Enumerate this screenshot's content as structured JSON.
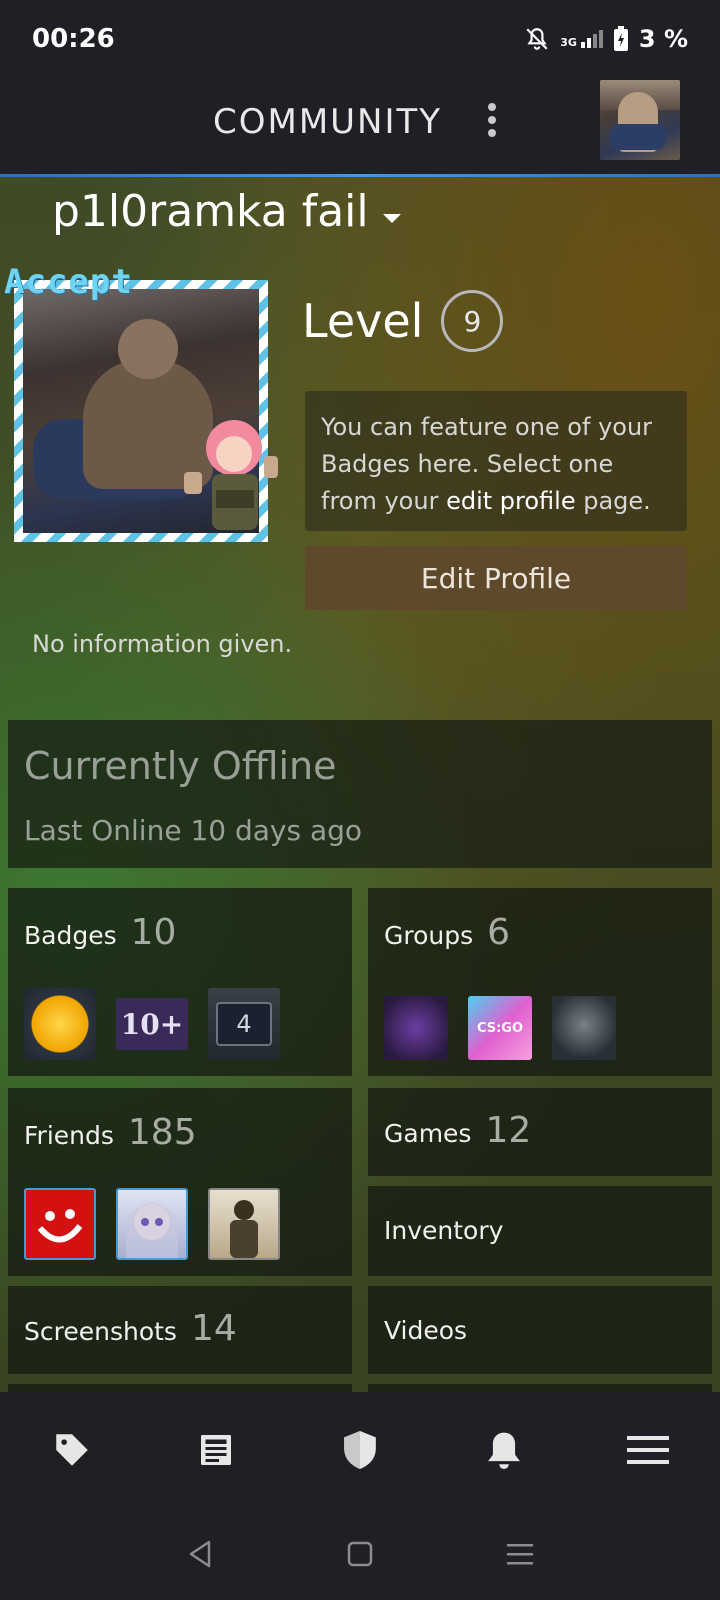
{
  "status_bar": {
    "time": "00:26",
    "battery": "3 %",
    "network": "3G"
  },
  "header": {
    "title": "COMMUNITY"
  },
  "profile": {
    "username": "p1l0ramka fail",
    "level_label": "Level",
    "level": "9",
    "feature_text_1": "You can feature one of your Badges here. Select one from your ",
    "feature_link": "edit profile",
    "feature_text_2": " page.",
    "edit_button": "Edit Profile",
    "summary": "No information given.",
    "frame_text": "Accept"
  },
  "status": {
    "state": "Currently Offline",
    "last_online": "Last Online 10 days ago"
  },
  "cards": {
    "badges": {
      "label": "Badges",
      "count": "10",
      "badge_10_text": "10+",
      "badge_4_text": "4"
    },
    "groups": {
      "label": "Groups",
      "count": "6",
      "group2_text": "CS:GO"
    },
    "friends": {
      "label": "Friends",
      "count": "185"
    },
    "games": {
      "label": "Games",
      "count": "12"
    },
    "inventory": {
      "label": "Inventory"
    },
    "screenshots": {
      "label": "Screenshots",
      "count": "14"
    },
    "videos": {
      "label": "Videos"
    }
  },
  "bottom_nav": [
    "store-icon",
    "news-icon",
    "guard-icon",
    "notifications-icon",
    "menu-icon"
  ],
  "colors": {
    "accent": "#3d9be0",
    "button": "#5e4a2a"
  }
}
